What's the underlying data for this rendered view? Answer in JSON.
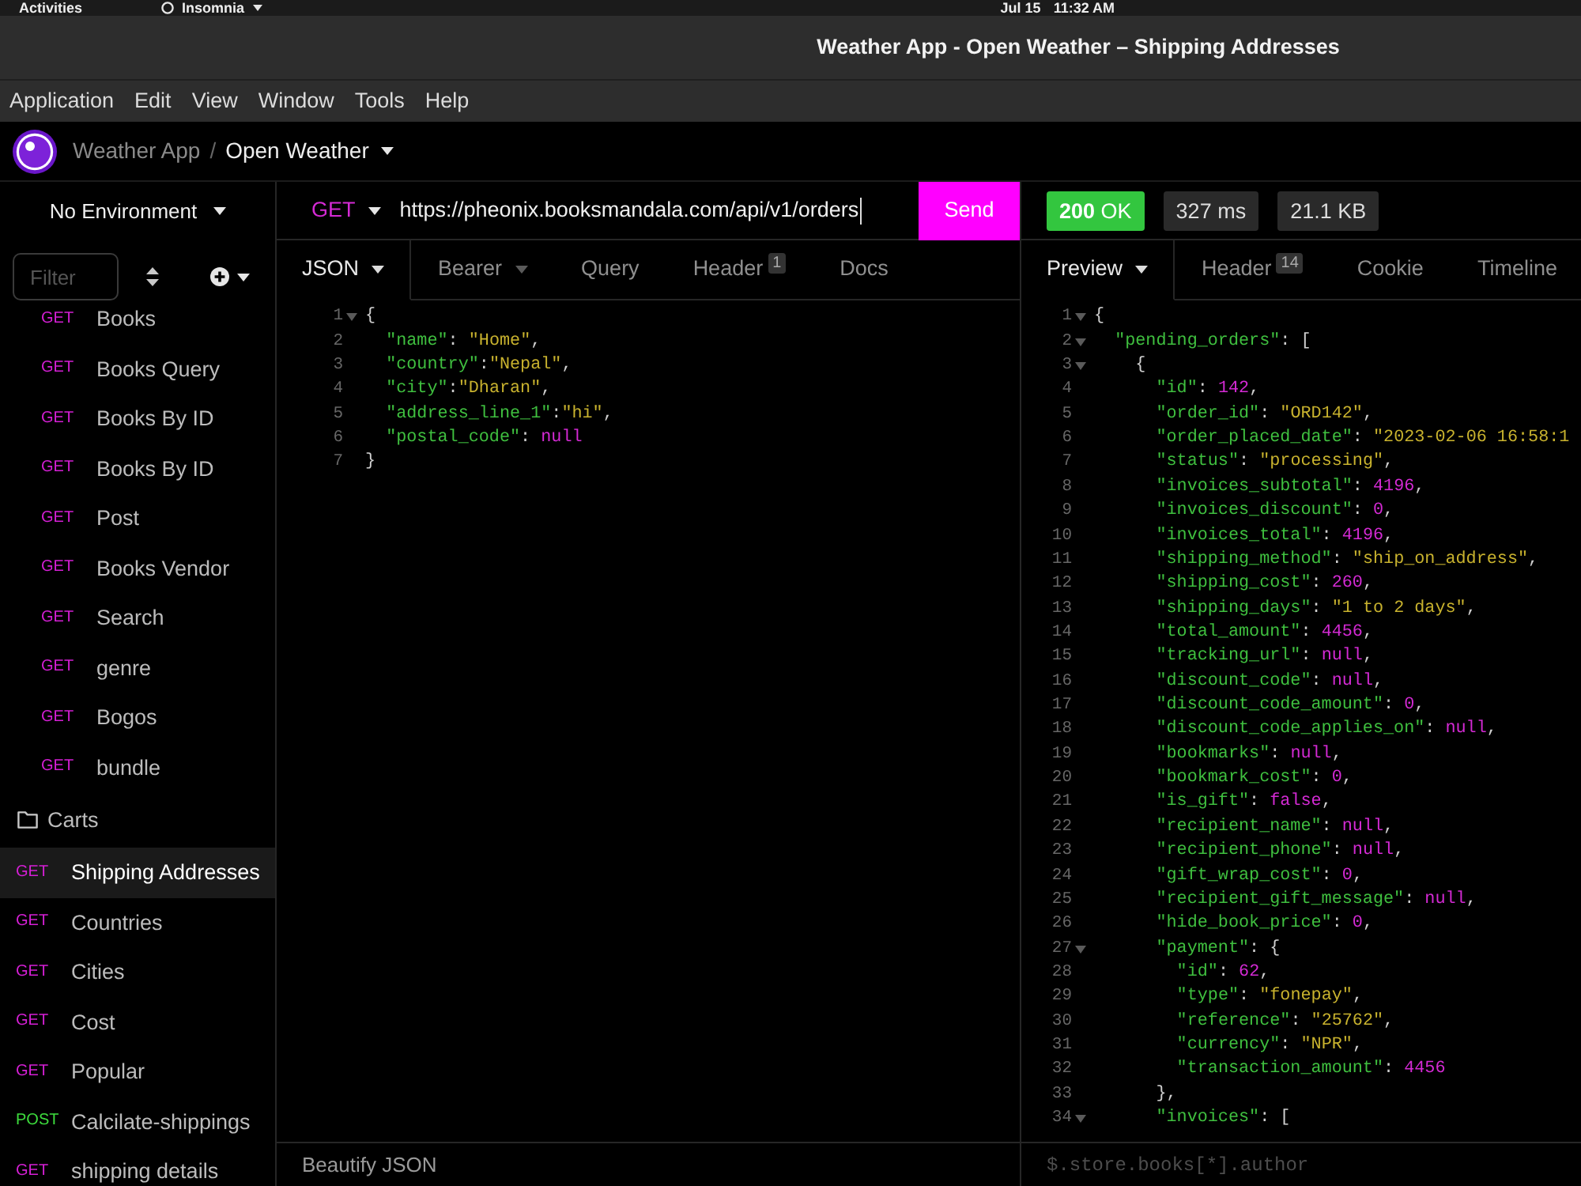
{
  "top_bar": {
    "activities": "Activities",
    "app": "Insomnia",
    "date": "Jul 15",
    "time": "11:32 AM"
  },
  "window": {
    "title": "Weather App - Open Weather – Shipping Addresses"
  },
  "menu": [
    "Application",
    "Edit",
    "View",
    "Window",
    "Tools",
    "Help"
  ],
  "breadcrumb": {
    "workspace": "Weather App",
    "separator": "/",
    "collection": "Open Weather"
  },
  "sidebar": {
    "environment": "No Environment",
    "filter": {
      "placeholder": "Filter"
    },
    "items": [
      {
        "kind": "folder",
        "children": [
          {
            "kind": "request",
            "method": "GET",
            "color": "#d61fd6",
            "label": "Books",
            "selected": false
          },
          {
            "kind": "request",
            "method": "GET",
            "color": "#d61fd6",
            "label": "Books Query",
            "selected": false
          },
          {
            "kind": "request",
            "method": "GET",
            "color": "#d61fd6",
            "label": "Books By ID",
            "selected": false
          },
          {
            "kind": "request",
            "method": "GET",
            "color": "#d61fd6",
            "label": "Books By ID",
            "selected": false
          },
          {
            "kind": "request",
            "method": "GET",
            "color": "#d61fd6",
            "label": "Post",
            "selected": false
          },
          {
            "kind": "request",
            "method": "GET",
            "color": "#d61fd6",
            "label": "Books Vendor",
            "selected": false
          },
          {
            "kind": "request",
            "method": "GET",
            "color": "#d61fd6",
            "label": "Search",
            "selected": false
          },
          {
            "kind": "request",
            "method": "GET",
            "color": "#d61fd6",
            "label": "genre",
            "selected": false
          },
          {
            "kind": "request",
            "method": "GET",
            "color": "#d61fd6",
            "label": "Bogos",
            "selected": false
          },
          {
            "kind": "request",
            "method": "GET",
            "color": "#d61fd6",
            "label": "bundle",
            "selected": false
          }
        ]
      },
      {
        "kind": "folder",
        "label": "Carts",
        "expanded": false
      },
      {
        "kind": "request",
        "method": "GET",
        "color": "#d61fd6",
        "label": "Shipping Addresses",
        "selected": true
      },
      {
        "kind": "request",
        "method": "GET",
        "color": "#d61fd6",
        "label": "Countries",
        "selected": false
      },
      {
        "kind": "request",
        "method": "GET",
        "color": "#d61fd6",
        "label": "Cities",
        "selected": false
      },
      {
        "kind": "request",
        "method": "GET",
        "color": "#d61fd6",
        "label": "Cost",
        "selected": false
      },
      {
        "kind": "request",
        "method": "GET",
        "color": "#d61fd6",
        "label": "Popular",
        "selected": false
      },
      {
        "kind": "request",
        "method": "POST",
        "color": "#3ddc3d",
        "label": "Calcilate-shippings",
        "selected": false
      },
      {
        "kind": "request",
        "method": "GET",
        "color": "#d61fd6",
        "label": "shipping details",
        "selected": false
      }
    ]
  },
  "request": {
    "method": "GET",
    "url": {
      "value": "https://pheonix.booksmandala.com/api/v1/orders",
      "focused": true
    },
    "send": "Send",
    "tabs": [
      {
        "label": "JSON",
        "selected": true,
        "dropdown": true
      },
      {
        "label": "Bearer",
        "selected": false,
        "dropdown": true
      },
      {
        "label": "Query",
        "selected": false,
        "dropdown": false
      },
      {
        "label": "Header",
        "selected": false,
        "dropdown": false,
        "count": "1"
      },
      {
        "label": "Docs",
        "selected": false,
        "dropdown": false
      }
    ],
    "body": [
      {
        "n": "1",
        "fold": true,
        "code": "{"
      },
      {
        "n": "2",
        "fold": false,
        "code": "  \"name\": \"Home\","
      },
      {
        "n": "3",
        "fold": false,
        "code": "  \"country\":\"Nepal\","
      },
      {
        "n": "4",
        "fold": false,
        "code": "  \"city\":\"Dharan\","
      },
      {
        "n": "5",
        "fold": false,
        "code": "  \"address_line_1\":\"hi\","
      },
      {
        "n": "6",
        "fold": false,
        "code": "  \"postal_code\": null"
      },
      {
        "n": "7",
        "fold": false,
        "code": "}"
      }
    ],
    "footer_button": "Beautify JSON"
  },
  "response": {
    "status": "**200** OK",
    "time": "327 ms",
    "size": "21.1 KB",
    "tabs": [
      {
        "label": "Preview",
        "selected": true,
        "dropdown": true
      },
      {
        "label": "Header",
        "selected": false,
        "dropdown": false,
        "count": "14"
      },
      {
        "label": "Cookie",
        "selected": false,
        "dropdown": false
      },
      {
        "label": "Timeline",
        "selected": false,
        "dropdown": false
      }
    ],
    "body": [
      {
        "n": "1",
        "fold": true,
        "code": "{"
      },
      {
        "n": "2",
        "fold": true,
        "code": "  \"pending_orders\": ["
      },
      {
        "n": "3",
        "fold": true,
        "code": "    {"
      },
      {
        "n": "4",
        "fold": false,
        "code": "      \"id\": 142,"
      },
      {
        "n": "5",
        "fold": false,
        "code": "      \"order_id\": \"ORD142\","
      },
      {
        "n": "6",
        "fold": false,
        "code": "      \"order_placed_date\": \"2023-02-06 16:58:1"
      },
      {
        "n": "7",
        "fold": false,
        "code": "      \"status\": \"processing\","
      },
      {
        "n": "8",
        "fold": false,
        "code": "      \"invoices_subtotal\": 4196,"
      },
      {
        "n": "9",
        "fold": false,
        "code": "      \"invoices_discount\": 0,"
      },
      {
        "n": "10",
        "fold": false,
        "code": "      \"invoices_total\": 4196,"
      },
      {
        "n": "11",
        "fold": false,
        "code": "      \"shipping_method\": \"ship_on_address\","
      },
      {
        "n": "12",
        "fold": false,
        "code": "      \"shipping_cost\": 260,"
      },
      {
        "n": "13",
        "fold": false,
        "code": "      \"shipping_days\": \"1 to 2 days\","
      },
      {
        "n": "14",
        "fold": false,
        "code": "      \"total_amount\": 4456,"
      },
      {
        "n": "15",
        "fold": false,
        "code": "      \"tracking_url\": null,"
      },
      {
        "n": "16",
        "fold": false,
        "code": "      \"discount_code\": null,"
      },
      {
        "n": "17",
        "fold": false,
        "code": "      \"discount_code_amount\": 0,"
      },
      {
        "n": "18",
        "fold": false,
        "code": "      \"discount_code_applies_on\": null,"
      },
      {
        "n": "19",
        "fold": false,
        "code": "      \"bookmarks\": null,"
      },
      {
        "n": "20",
        "fold": false,
        "code": "      \"bookmark_cost\": 0,"
      },
      {
        "n": "21",
        "fold": false,
        "code": "      \"is_gift\": false,"
      },
      {
        "n": "22",
        "fold": false,
        "code": "      \"recipient_name\": null,"
      },
      {
        "n": "23",
        "fold": false,
        "code": "      \"recipient_phone\": null,"
      },
      {
        "n": "24",
        "fold": false,
        "code": "      \"gift_wrap_cost\": 0,"
      },
      {
        "n": "25",
        "fold": false,
        "code": "      \"recipient_gift_message\": null,"
      },
      {
        "n": "26",
        "fold": false,
        "code": "      \"hide_book_price\": 0,"
      },
      {
        "n": "27",
        "fold": true,
        "code": "      \"payment\": {"
      },
      {
        "n": "28",
        "fold": false,
        "code": "        \"id\": 62,"
      },
      {
        "n": "29",
        "fold": false,
        "code": "        \"type\": \"fonepay\","
      },
      {
        "n": "30",
        "fold": false,
        "code": "        \"reference\": \"25762\","
      },
      {
        "n": "31",
        "fold": false,
        "code": "        \"currency\": \"NPR\","
      },
      {
        "n": "32",
        "fold": false,
        "code": "        \"transaction_amount\": 4456"
      },
      {
        "n": "33",
        "fold": false,
        "code": "      },"
      },
      {
        "n": "34",
        "fold": true,
        "code": "      \"invoices\": ["
      }
    ],
    "filter": {
      "placeholder": "$.store.books[*].author"
    }
  }
}
